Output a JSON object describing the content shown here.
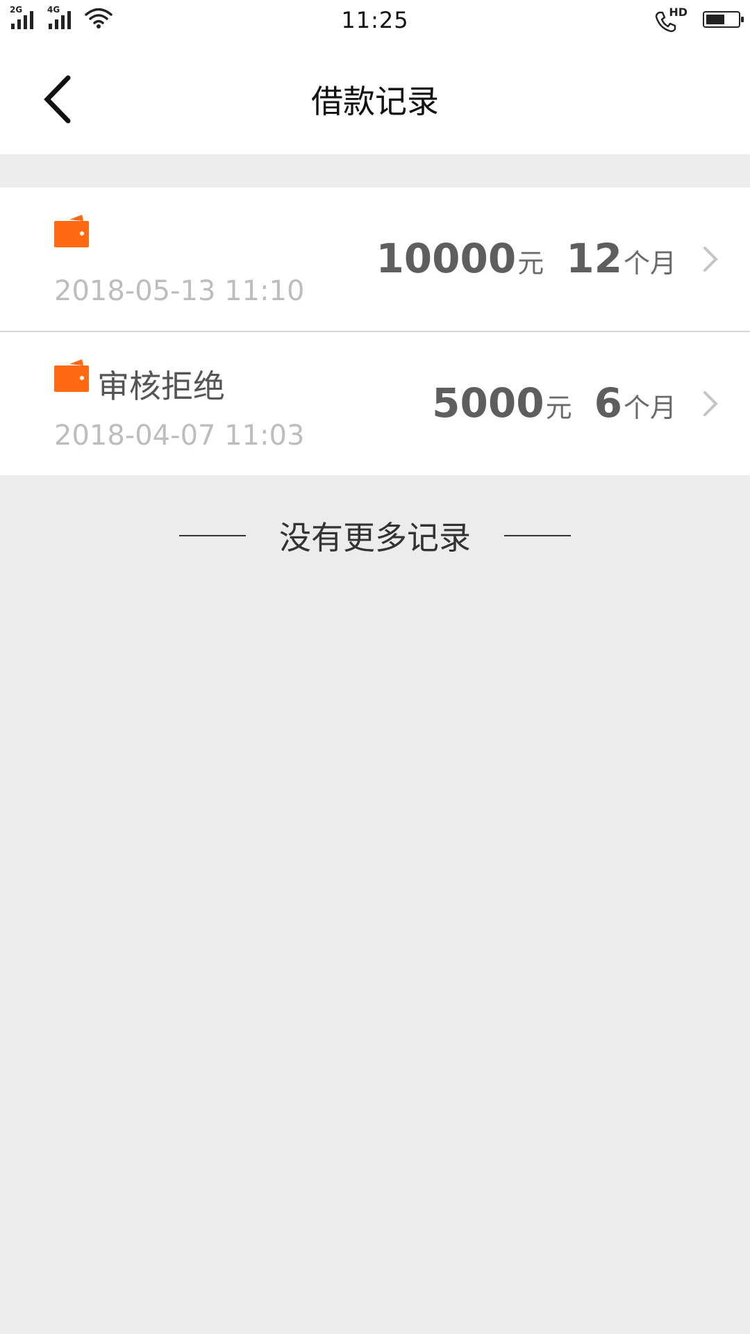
{
  "status_bar": {
    "signal1_tag": "2G",
    "signal2_tag": "4G",
    "time": "11:25",
    "call_tag": "HD",
    "battery_level": 0.6
  },
  "nav": {
    "title": "借款记录"
  },
  "records": [
    {
      "status": "",
      "date": "2018-05-13 11:10",
      "amount": "10000",
      "amount_unit": "元",
      "term": "12",
      "term_unit": "个月"
    },
    {
      "status": "审核拒绝",
      "date": "2018-04-07 11:03",
      "amount": "5000",
      "amount_unit": "元",
      "term": "6",
      "term_unit": "个月"
    }
  ],
  "footer": {
    "no_more_text": "没有更多记录"
  },
  "colors": {
    "wallet_orange": "#ff6a13",
    "background": "#ececec"
  },
  "icons": {
    "back": "back-arrow-icon",
    "wallet": "wallet-icon",
    "chevron": "chevron-right-icon"
  }
}
